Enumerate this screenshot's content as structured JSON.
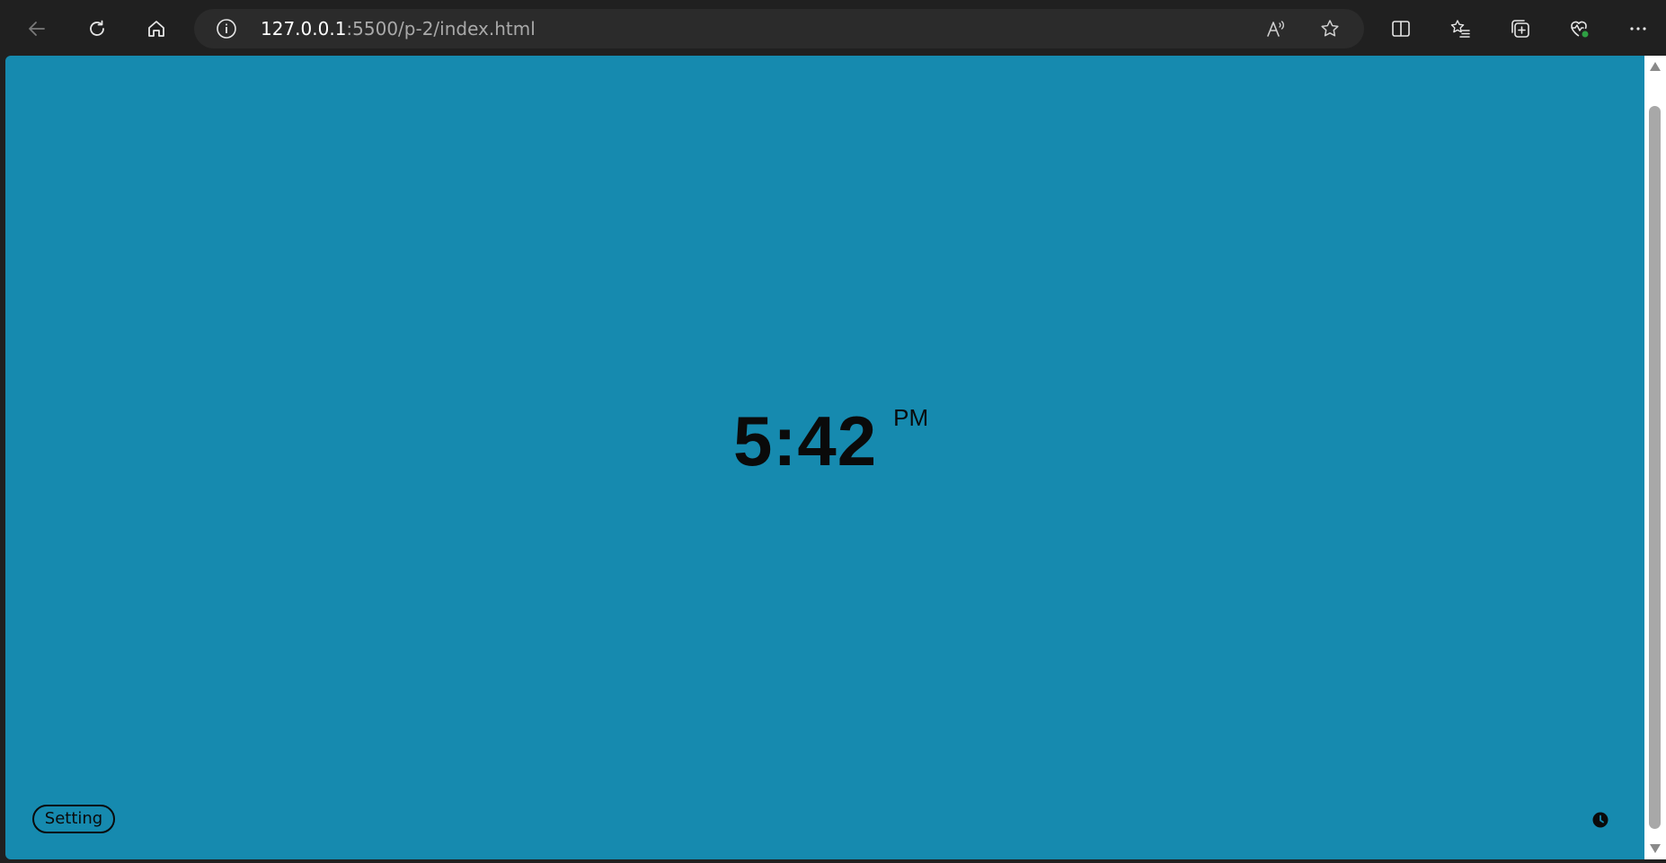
{
  "browser": {
    "url_host": "127.0.0.1",
    "url_path": ":5500/p-2/index.html",
    "icons": {
      "back": "back-arrow-icon",
      "refresh": "refresh-icon",
      "home": "home-icon",
      "info": "info-icon",
      "read_aloud": "read-aloud-icon",
      "favorite": "star-icon",
      "split_screen": "split-screen-icon",
      "favorites": "favorites-list-icon",
      "collections": "collections-icon",
      "performance": "heartbeat-icon",
      "more": "more-icon"
    }
  },
  "page": {
    "background_color": "#168aaf",
    "clock": {
      "time": "5:42",
      "period": "PM"
    },
    "setting_label": "Setting",
    "clock_icon": "clock-icon"
  }
}
